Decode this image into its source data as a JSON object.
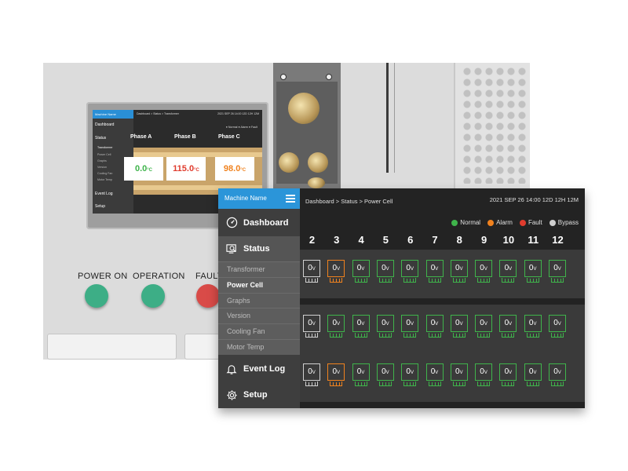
{
  "colors": {
    "normal": "#3fb44b",
    "alarm": "#f0821e",
    "fault": "#e03c2e",
    "bypass": "#cfcfcf",
    "header_blue": "#2b95d9"
  },
  "small_screen": {
    "machine_name": "Machine Name",
    "breadcrumb": "Dashboard > Status > Transformer",
    "datetime": "2021 SEP 26 14:00 12D 12H 12M",
    "nav": [
      "Dashboard",
      "Status",
      "Event Log",
      "Setup"
    ],
    "sub_items": [
      "Transformer",
      "Power Cell",
      "Graphs",
      "Version",
      "Cooling Fan",
      "Motor Temp"
    ],
    "legend": "● Normal ● Alarm ● Fault",
    "phases": [
      "Phase A",
      "Phase B",
      "Phase C"
    ],
    "temps": [
      {
        "value": "0.0",
        "unit": "°C",
        "color": "#3fb44b"
      },
      {
        "value": "115.0",
        "unit": "°C",
        "color": "#e03c2e"
      },
      {
        "value": "98.0",
        "unit": "°C",
        "color": "#f0821e"
      }
    ]
  },
  "lamps": [
    {
      "label": "POWER ON",
      "color": "#3dae86"
    },
    {
      "label": "OPERATION",
      "color": "#3dae86"
    },
    {
      "label": "FAULT",
      "color": "#d94b48"
    }
  ],
  "sidebar": {
    "machine_name": "Machine Name",
    "dashboard": {
      "label": "Dashboard",
      "icon": "gauge-icon"
    },
    "status": {
      "label": "Status",
      "icon": "monitor-search-icon"
    },
    "sub_items": [
      {
        "label": "Transformer",
        "active": false
      },
      {
        "label": "Power Cell",
        "active": true
      },
      {
        "label": "Graphs",
        "active": false
      },
      {
        "label": "Version",
        "active": false
      },
      {
        "label": "Cooling Fan",
        "active": false
      },
      {
        "label": "Motor Temp",
        "active": false
      }
    ],
    "event_log": {
      "label": "Event Log",
      "icon": "bell-icon"
    },
    "setup": {
      "label": "Setup",
      "icon": "gear-icon"
    }
  },
  "header": {
    "breadcrumb": "Dashboard > Status > Power Cell",
    "datetime": "2021 SEP 26 14:00  12D 12H 12M"
  },
  "legend": [
    {
      "label": "Normal",
      "color": "#3fb44b"
    },
    {
      "label": "Alarm",
      "color": "#f0821e"
    },
    {
      "label": "Fault",
      "color": "#e03c2e"
    },
    {
      "label": "Bypass",
      "color": "#cfcfcf"
    }
  ],
  "columns": [
    "2",
    "3",
    "4",
    "5",
    "6",
    "7",
    "8",
    "9",
    "10",
    "11",
    "12"
  ],
  "rows": [
    [
      "bypass",
      "alarm",
      "normal",
      "normal",
      "normal",
      "normal",
      "normal",
      "normal",
      "normal",
      "normal",
      "normal"
    ],
    [
      "bypass",
      "normal",
      "normal",
      "normal",
      "normal",
      "normal",
      "normal",
      "normal",
      "normal",
      "normal",
      "normal"
    ],
    [
      "bypass",
      "alarm",
      "normal",
      "normal",
      "normal",
      "normal",
      "normal",
      "normal",
      "normal",
      "normal",
      "normal"
    ]
  ],
  "cell_value": "0",
  "cell_unit": "V"
}
